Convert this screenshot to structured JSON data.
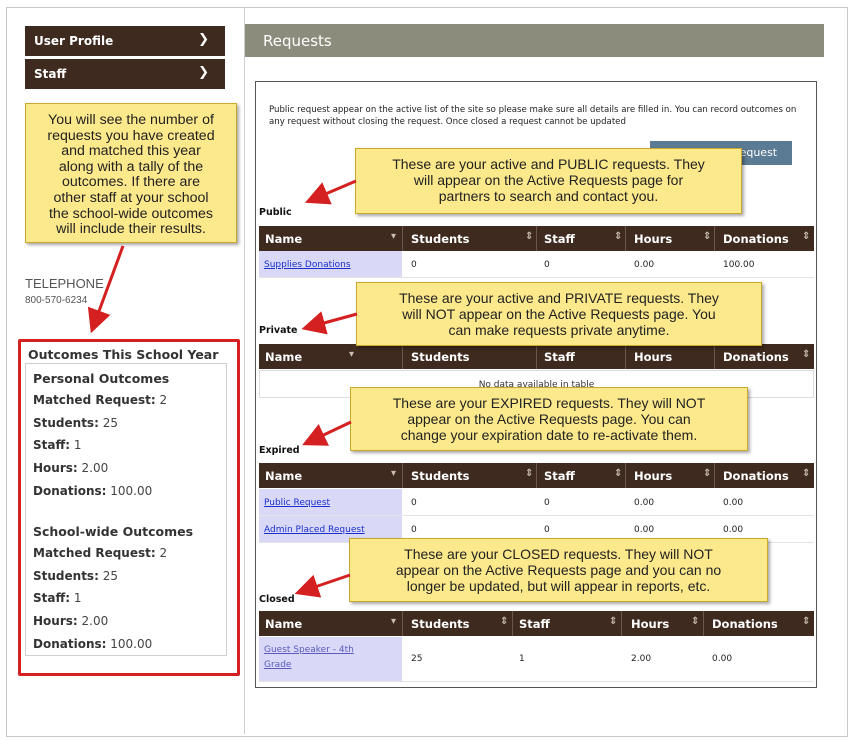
{
  "sidebar": {
    "user_profile": "User Profile",
    "staff": "Staff",
    "telephone_label": "TELEPHONE",
    "telephone_number": "800-570-6234",
    "outcomes": {
      "title": "Outcomes This School Year",
      "personal": {
        "heading": "Personal Outcomes",
        "matched_label": "Matched Request:",
        "matched_value": "2",
        "students_label": "Students:",
        "students_value": "25",
        "staff_label": "Staff:",
        "staff_value": "1",
        "hours_label": "Hours:",
        "hours_value": "2.00",
        "donations_label": "Donations:",
        "donations_value": "100.00"
      },
      "school": {
        "heading": "School-wide Outcomes",
        "matched_label": "Matched Request:",
        "matched_value": "2",
        "students_label": "Students:",
        "students_value": "25",
        "staff_label": "Staff:",
        "staff_value": "1",
        "hours_label": "Hours:",
        "hours_value": "2.00",
        "donations_label": "Donations:",
        "donations_value": "100.00"
      }
    }
  },
  "callouts": {
    "sidebar": [
      "You will see the number of",
      "requests you have created",
      "and matched this year",
      "along with a tally of the",
      "outcomes. If there are",
      "other staff at your school",
      "the school-wide outcomes",
      "will include their results."
    ],
    "public": [
      "These are your active and PUBLIC requests. They",
      "will appear on the Active Requests page for",
      "partners to search and contact you."
    ],
    "private": [
      "These are your active and PRIVATE requests. They",
      "will NOT appear on the Active Requests page. You",
      "can make requests private anytime."
    ],
    "expired": [
      "These are your EXPIRED requests. They will NOT",
      "appear on the Active Requests page. You can",
      "change your expiration date to re-activate them."
    ],
    "closed": [
      "These are your CLOSED requests. They will NOT",
      "appear on the Active Requests page and you can no",
      "longer be updated, but will appear in reports, etc."
    ]
  },
  "main": {
    "title": "Requests",
    "intro": "Public request appear on the active list of the site so please make sure all details are filled in. You can record outcomes on any request without closing the request. Once closed a request cannot be updated",
    "new_request_button": "Create New Request",
    "columns": [
      "Name",
      "Students",
      "Staff",
      "Hours",
      "Donations"
    ],
    "sections": {
      "public": {
        "label": "Public",
        "rows": [
          [
            "Supplies Donations",
            "0",
            "0",
            "0.00",
            "100.00"
          ]
        ]
      },
      "private": {
        "label": "Private",
        "empty_text": "No data available in table"
      },
      "expired": {
        "label": "Expired",
        "rows": [
          [
            "Public Request",
            "0",
            "0",
            "0.00",
            "0.00"
          ],
          [
            "Admin Placed Request",
            "0",
            "0",
            "0.00",
            "0.00"
          ]
        ]
      },
      "closed": {
        "label": "Closed",
        "rows": [
          [
            "Guest Speaker - 4th Grade",
            "25",
            "1",
            "2.00",
            "0.00"
          ]
        ]
      }
    }
  },
  "colors": {
    "sidebar_button": "#3e2a1e",
    "header_bar": "#8c8c7d",
    "callout_fill": "#fce98c",
    "highlight_border": "#d42020",
    "arrow": "#d42020",
    "new_request_button": "#5b7a93"
  }
}
